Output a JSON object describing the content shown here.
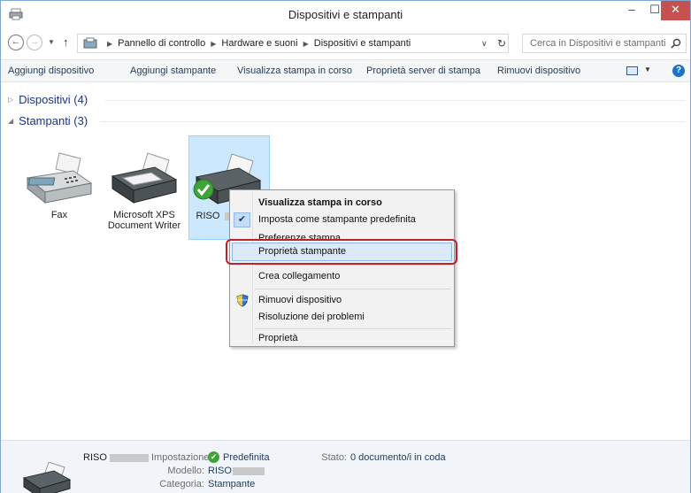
{
  "window": {
    "title": "Dispositivi e stampanti"
  },
  "titlebar_buttons": {
    "minimize": "–",
    "maximize": "☐",
    "close": "✕"
  },
  "address": {
    "crumbs": [
      "Pannello di controllo",
      "Hardware e suoni",
      "Dispositivi e stampanti"
    ],
    "search_placeholder": "Cerca in Dispositivi e stampanti"
  },
  "commands": [
    "Aggiungi dispositivo",
    "Aggiungi stampante",
    "Visualizza stampa in corso",
    "Proprietà server di stampa",
    "Rimuovi dispositivo"
  ],
  "groups": {
    "devices": {
      "label": "Dispositivi (4)",
      "expanded": false
    },
    "printers": {
      "label": "Stampanti (3)",
      "expanded": true
    }
  },
  "printers": [
    {
      "name": "Fax",
      "selected": false
    },
    {
      "name": "Microsoft XPS Document Writer",
      "selected": false
    },
    {
      "name": "RISO",
      "selected": true,
      "default": true
    }
  ],
  "context_menu": {
    "items": [
      {
        "label": "Visualizza stampa in corso",
        "bold": true
      },
      {
        "label": "Imposta come stampante predefinita",
        "checked": true
      },
      {
        "label": "Preferenze stampa"
      },
      {
        "label": "Proprietà stampante",
        "highlighted": true
      },
      {
        "label": "Crea collegamento"
      },
      {
        "label": "Rimuovi dispositivo",
        "icon": "uac-shield-icon"
      },
      {
        "label": "Risoluzione dei problemi"
      },
      {
        "label": "Proprietà"
      }
    ]
  },
  "details": {
    "name": "RISO",
    "setting_key": "Impostazione:",
    "setting_value": "Predefinita",
    "status_key": "Stato:",
    "status_value": "0 documento/i in coda",
    "model_key": "Modello:",
    "model_value": "RISO",
    "category_key": "Categoria:",
    "category_value": "Stampante"
  },
  "colors": {
    "selection": "#cce8ff",
    "highlight_ring": "#c0202a",
    "close_button": "#c75050",
    "link_text": "#1e395b"
  }
}
